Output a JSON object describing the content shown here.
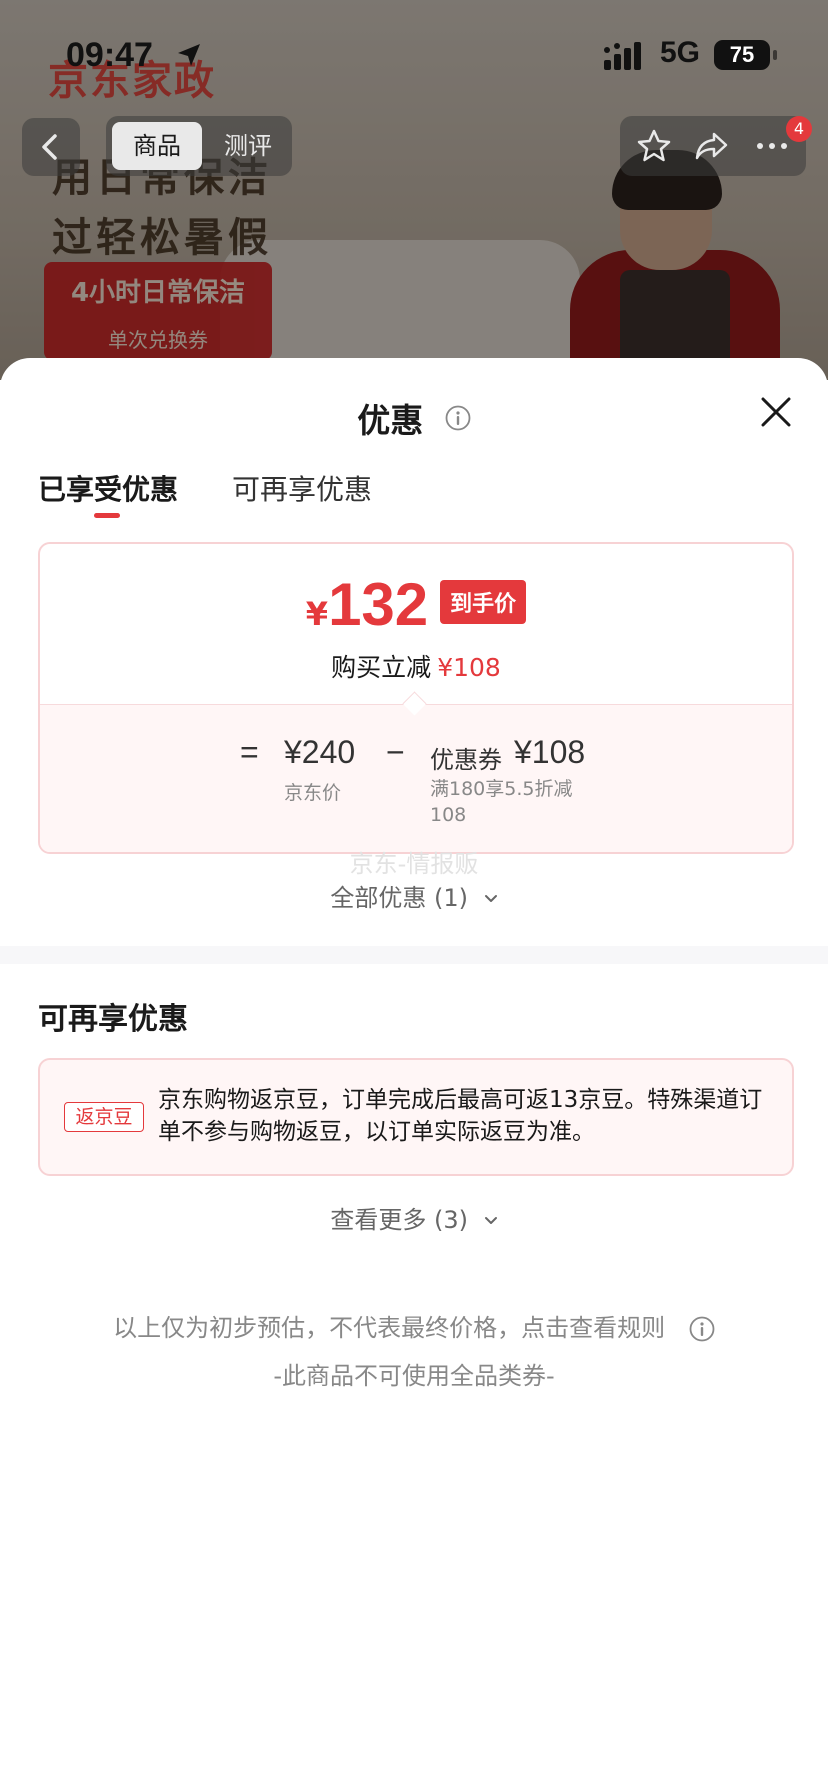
{
  "status_bar": {
    "time": "09:47",
    "network": "5G",
    "battery": "75"
  },
  "background": {
    "brand": "京东家政",
    "promo_line_1": "用日常保洁",
    "promo_line_2": "过轻松暑假",
    "promo_box_title": "4小时日常保洁",
    "promo_box_subtitle": "单次兑换券"
  },
  "nav": {
    "tabs": [
      "商品",
      "测评"
    ],
    "badge": "4"
  },
  "sheet": {
    "title": "优惠",
    "tabs": [
      "已享受优惠",
      "可再享优惠"
    ],
    "deal": {
      "currency": "¥",
      "final_price": "132",
      "final_price_tag": "到手价",
      "reduce_label": "购买立减",
      "reduce_amount": "¥108",
      "eq": "=",
      "jd_price": "¥240",
      "jd_price_label": "京东价",
      "minus": "−",
      "coupon_label": "优惠券",
      "coupon_amount": "¥108",
      "coupon_rule": "满180享5.5折减108"
    },
    "watermark": "京东-情报贩",
    "all_deals": "全部优惠 (1)",
    "section_title": "可再享优惠",
    "bean": {
      "tag": "返京豆",
      "text": "京东购物返京豆，订单完成后最高可返13京豆。特殊渠道订单不参与购物返豆，以订单实际返豆为准。"
    },
    "more": "查看更多 (3)",
    "disclaimer": "以上仅为初步预估，不代表最终价格，点击查看规则",
    "disclaimer_2": "-此商品不可使用全品类券-"
  },
  "colors": {
    "accent": "#e4393c",
    "card_border": "#f7d2d4",
    "card_bg": "#fff6f6"
  }
}
